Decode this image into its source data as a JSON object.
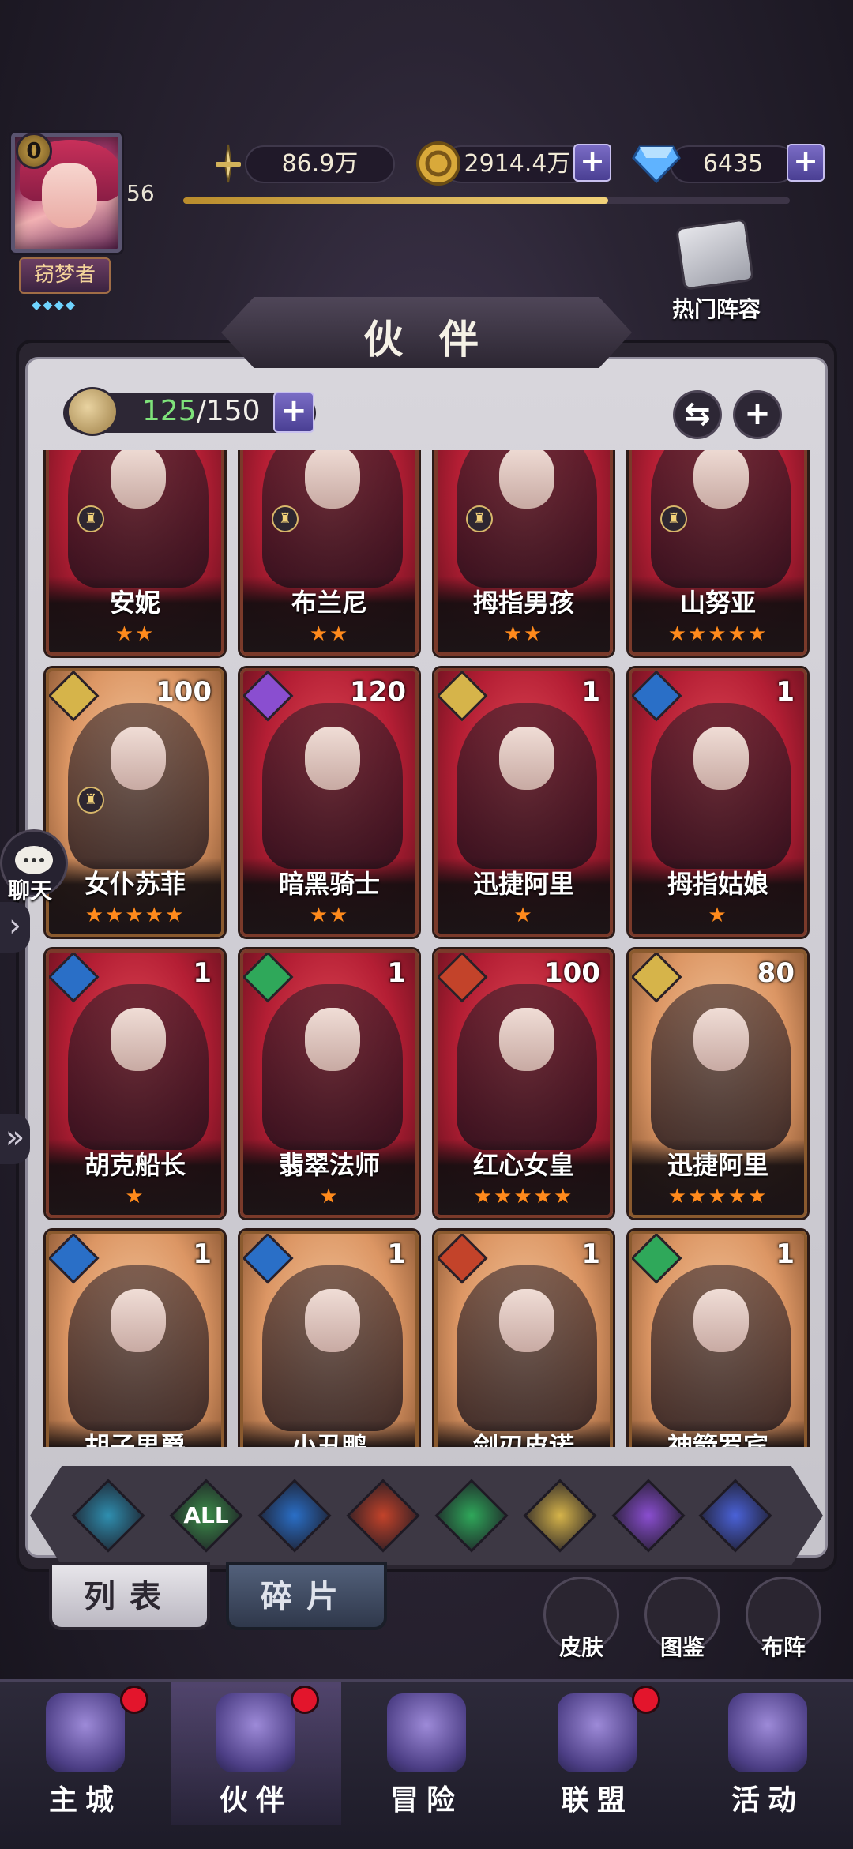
{
  "player": {
    "vip": "0",
    "level": "56",
    "title": "窃梦者",
    "exp_progress": 0.7
  },
  "resources": [
    {
      "id": "power",
      "icon": "sword-icon",
      "value": "86.9万",
      "has_plus": false
    },
    {
      "id": "gold",
      "icon": "gold-coin-icon",
      "value": "2914.4万",
      "has_plus": true
    },
    {
      "id": "diamond",
      "icon": "diamond-icon",
      "value": "6435",
      "has_plus": true
    }
  ],
  "hot_lineup": "热门阵容",
  "panel_title": "伙 伴",
  "roster": {
    "current": "125",
    "max": "/150"
  },
  "chat_label": "聊天",
  "cards": [
    {
      "name": "安妮",
      "stars": 2,
      "level": "",
      "element": "",
      "bg": "red",
      "lock": true
    },
    {
      "name": "布兰尼",
      "stars": 2,
      "level": "",
      "element": "",
      "bg": "red",
      "lock": true
    },
    {
      "name": "拇指男孩",
      "stars": 2,
      "level": "",
      "element": "",
      "bg": "red",
      "lock": true
    },
    {
      "name": "山努亚",
      "stars": 5,
      "level": "",
      "element": "",
      "bg": "red",
      "lock": true
    },
    {
      "name": "女仆苏菲",
      "stars": 5,
      "level": "100",
      "element": "light",
      "bg": "gold",
      "lock": true
    },
    {
      "name": "暗黑骑士",
      "stars": 2,
      "level": "120",
      "element": "dark",
      "bg": "red",
      "lock": false
    },
    {
      "name": "迅捷阿里",
      "stars": 1,
      "level": "1",
      "element": "light",
      "bg": "red",
      "lock": false
    },
    {
      "name": "拇指姑娘",
      "stars": 1,
      "level": "1",
      "element": "water",
      "bg": "red",
      "lock": false
    },
    {
      "name": "胡克船长",
      "stars": 1,
      "level": "1",
      "element": "water",
      "bg": "red",
      "lock": false
    },
    {
      "name": "翡翠法师",
      "stars": 1,
      "level": "1",
      "element": "wind",
      "bg": "red",
      "lock": false
    },
    {
      "name": "红心女皇",
      "stars": 5,
      "level": "100",
      "element": "fire",
      "bg": "red",
      "lock": false
    },
    {
      "name": "迅捷阿里",
      "stars": 5,
      "level": "80",
      "element": "light",
      "bg": "gold",
      "lock": false
    },
    {
      "name": "胡子男爵",
      "stars": 0,
      "level": "1",
      "element": "water",
      "bg": "gold",
      "lock": false
    },
    {
      "name": "小丑鸭",
      "stars": 0,
      "level": "1",
      "element": "water",
      "bg": "gold",
      "lock": false
    },
    {
      "name": "剑刃皮诺",
      "stars": 0,
      "level": "1",
      "element": "fire",
      "bg": "gold",
      "lock": false
    },
    {
      "name": "神箭罗宾",
      "stars": 0,
      "level": "1",
      "element": "wind",
      "bg": "gold",
      "lock": false
    }
  ],
  "element_filters": [
    {
      "id": "teal",
      "label": "",
      "color": "#2f8fb0"
    },
    {
      "id": "all",
      "label": "ALL",
      "color": "#3c8e4a"
    },
    {
      "id": "water",
      "label": "",
      "color": "#2a6fc7"
    },
    {
      "id": "fire",
      "label": "",
      "color": "#c3432a"
    },
    {
      "id": "wind",
      "label": "",
      "color": "#2fa85a"
    },
    {
      "id": "light",
      "label": "",
      "color": "#d6b44a"
    },
    {
      "id": "dark",
      "label": "",
      "color": "#8a4ed0"
    },
    {
      "id": "cosmic",
      "label": "",
      "color": "#4a62d8"
    }
  ],
  "element_colors": {
    "light": "#d6b44a",
    "dark": "#8a4ed0",
    "water": "#2a6fc7",
    "wind": "#2fa85a",
    "fire": "#c3432a"
  },
  "tabs": {
    "list": "列表",
    "fragments": "碎片"
  },
  "side_buttons": [
    {
      "id": "skin",
      "label": "皮肤",
      "icon": "skin-icon"
    },
    {
      "id": "codex",
      "label": "图鉴",
      "icon": "codex-icon"
    },
    {
      "id": "formation",
      "label": "布阵",
      "icon": "formation-icon"
    }
  ],
  "nav": [
    {
      "id": "main-city",
      "label": "主城",
      "icon": "castle-icon",
      "badge": true,
      "active": false
    },
    {
      "id": "partners",
      "label": "伙伴",
      "icon": "witch-hat-icon",
      "badge": true,
      "active": true
    },
    {
      "id": "adventure",
      "label": "冒险",
      "icon": "compass-icon",
      "badge": false,
      "active": false
    },
    {
      "id": "alliance",
      "label": "联盟",
      "icon": "shield-icon",
      "badge": true,
      "active": false
    },
    {
      "id": "events",
      "label": "活动",
      "icon": "cards-icon",
      "badge": false,
      "active": false
    }
  ]
}
